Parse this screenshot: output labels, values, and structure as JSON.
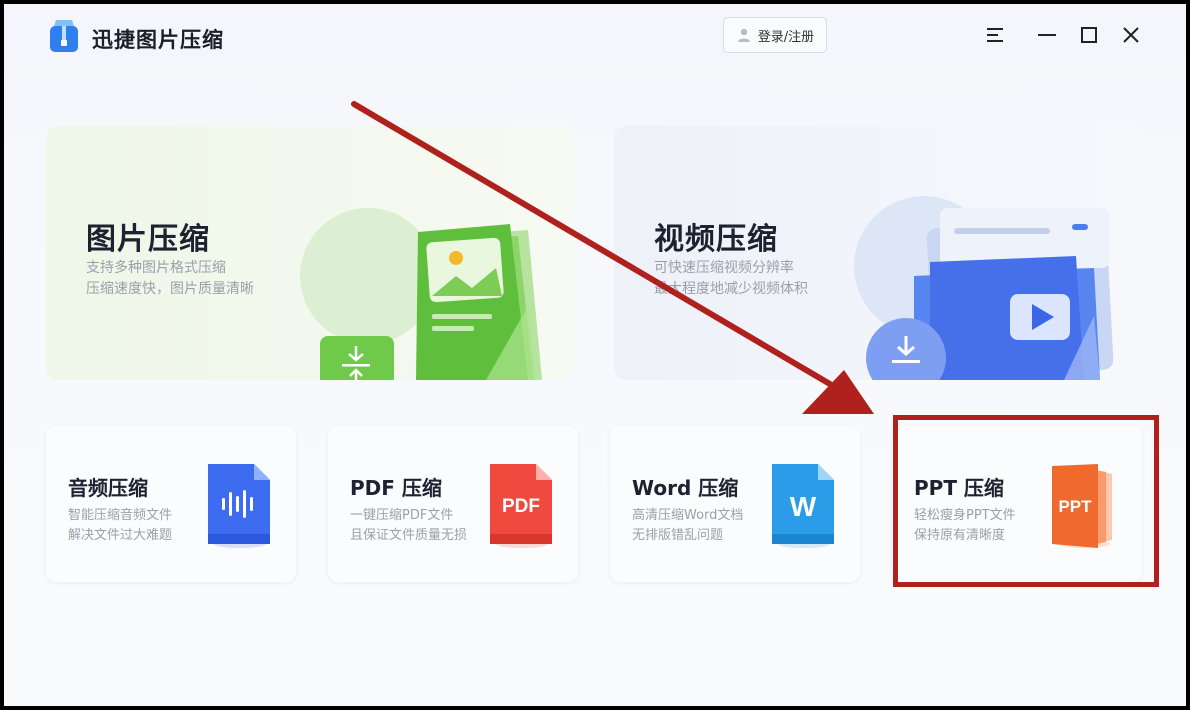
{
  "app": {
    "title": "迅捷图片压缩",
    "login_label": "登录/注册"
  },
  "window_controls": [
    "menu-icon",
    "minimize-icon",
    "maximize-icon",
    "close-icon"
  ],
  "feature_cards": [
    {
      "title": "图片压缩",
      "desc_line1": "支持多种图片格式压缩",
      "desc_line2": "压缩速度快，图片质量清晰"
    },
    {
      "title": "视频压缩",
      "desc_line1": "可快速压缩视频分辨率",
      "desc_line2": "最大程度地减少视频体积"
    }
  ],
  "tool_cards": [
    {
      "title": "音频压缩",
      "desc_line1": "智能压缩音频文件",
      "desc_line2": "解决文件过大难题",
      "icon": "audio-file-icon",
      "color": "#3d6cf0"
    },
    {
      "title": "PDF 压缩",
      "desc_line1": "一键压缩PDF文件",
      "desc_line2": "且保证文件质量无损",
      "icon": "pdf-file-icon",
      "icon_label": "PDF",
      "color": "#f04a3e"
    },
    {
      "title": "Word 压缩",
      "desc_line1": "高清压缩Word文档",
      "desc_line2": "无排版错乱问题",
      "icon": "word-file-icon",
      "icon_label": "W",
      "color": "#2a9ce8"
    },
    {
      "title": "PPT 压缩",
      "desc_line1": "轻松瘦身PPT文件",
      "desc_line2": "保持原有清晰度",
      "icon": "ppt-file-icon",
      "icon_label": "PPT",
      "color": "#f06a2e"
    }
  ],
  "annotation": {
    "color": "#b0201c"
  }
}
